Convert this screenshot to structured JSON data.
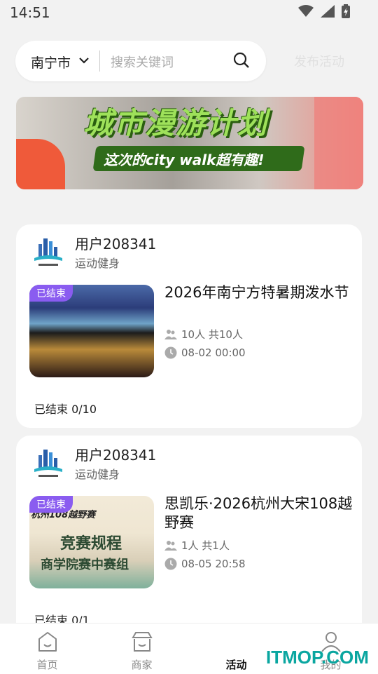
{
  "status_bar": {
    "time": "14:51"
  },
  "search": {
    "city": "南宁市",
    "placeholder": "搜索关键词"
  },
  "publish_label": "发布活动",
  "banner": {
    "title": "城市漫游计划",
    "subtitle": "这次的city walk超有趣!"
  },
  "activities": [
    {
      "user": "用户208341",
      "category": "运动健身",
      "tag": "已结束",
      "title": "2026年南宁方特暑期泼水节",
      "people": "10人 共10人",
      "date": "08-02 00:00",
      "status": "已结束 0/10"
    },
    {
      "user": "用户208341",
      "category": "运动健身",
      "tag": "已结束",
      "title": "思凯乐·2026杭州大宋108越野赛",
      "people": "1人 共1人",
      "date": "08-05 20:58",
      "status": "已结束 0/1",
      "poster_line0": "杭州108越野赛",
      "poster_line1": "竞赛规程",
      "poster_line2": "商学院赛中赛组"
    }
  ],
  "tabs": [
    {
      "label": "首页",
      "icon": "home-icon"
    },
    {
      "label": "商家",
      "icon": "store-icon"
    },
    {
      "label": "活动",
      "icon": "activity-icon",
      "active": true
    },
    {
      "label": "我的",
      "icon": "profile-icon"
    }
  ],
  "watermark": "ITMOP.COM"
}
